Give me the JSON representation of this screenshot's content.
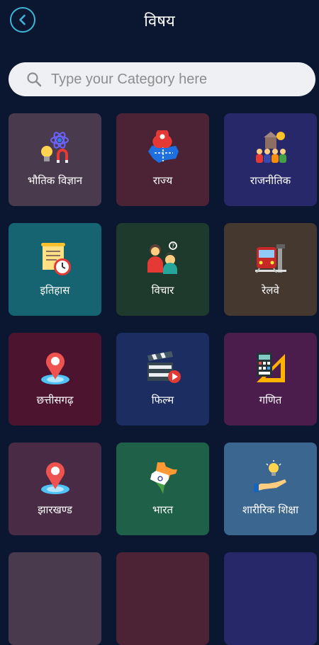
{
  "header": {
    "title": "विषय"
  },
  "search": {
    "placeholder": "Type your Category here"
  },
  "categories": [
    {
      "label": "भौतिक विज्ञान",
      "color": "#4a3a4d",
      "icon": "physics-icon"
    },
    {
      "label": "राज्य",
      "color": "#4b2334",
      "icon": "state-map-pin-icon"
    },
    {
      "label": "राजनीतिक",
      "color": "#26286a",
      "icon": "politics-people-icon"
    },
    {
      "label": "इतिहास",
      "color": "#166371",
      "icon": "history-scroll-clock-icon"
    },
    {
      "label": "विचार",
      "color": "#1e3a2c",
      "icon": "thought-people-icon"
    },
    {
      "label": "रेलवे",
      "color": "#44382f",
      "icon": "train-icon"
    },
    {
      "label": "छत्तीसगढ़",
      "color": "#4d1430",
      "icon": "location-pin-icon"
    },
    {
      "label": "फिल्म",
      "color": "#1c2d62",
      "icon": "film-clapper-icon"
    },
    {
      "label": "गणित",
      "color": "#4b1d4c",
      "icon": "math-calculator-ruler-icon"
    },
    {
      "label": "झारखण्ड",
      "color": "#4a2b45",
      "icon": "location-pin-icon"
    },
    {
      "label": "भारत",
      "color": "#1f6049",
      "icon": "india-map-icon"
    },
    {
      "label": "शारीरिक शिक्षा",
      "color": "#3b6690",
      "icon": "hand-bulb-icon"
    }
  ],
  "partial_row_colors": [
    "#4a3a4d",
    "#4b2334",
    "#26286a"
  ]
}
